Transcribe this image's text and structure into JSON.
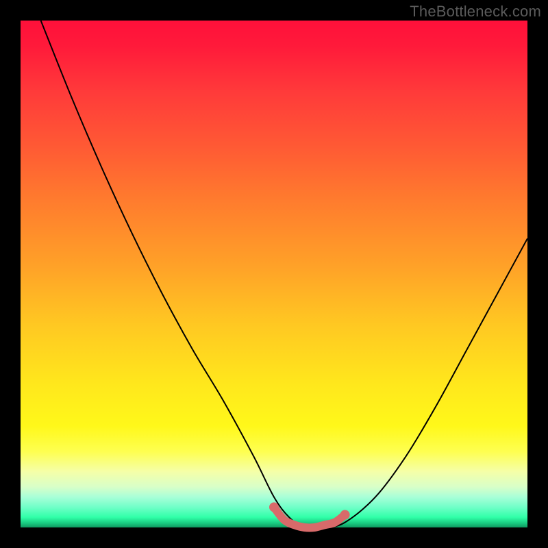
{
  "attribution": "TheBottleneck.com",
  "colors": {
    "frame": "#000000",
    "curve_main": "#000000",
    "curve_bottom_accent": "#d86a6a",
    "text": "#5b5b5b",
    "gradient_top": "#ff103a",
    "gradient_mid_upper": "#ff7a2e",
    "gradient_mid": "#ffe81c",
    "gradient_lower": "#feff50",
    "gradient_bottom": "#18c87e"
  },
  "chart_data": {
    "type": "line",
    "title": "",
    "xlabel": "",
    "ylabel": "",
    "xlim": [
      0,
      100
    ],
    "ylim": [
      0,
      100
    ],
    "grid": false,
    "legend": false,
    "series": [
      {
        "name": "bottleneck-curve",
        "x": [
          4,
          10,
          16,
          22,
          28,
          34,
          40,
          46,
          50,
          53,
          56,
          60,
          64,
          70,
          76,
          82,
          88,
          94,
          100
        ],
        "y": [
          100,
          85,
          71,
          58,
          46,
          35,
          25,
          14,
          6,
          2,
          0,
          0,
          1,
          6,
          14,
          24,
          35,
          46,
          57
        ]
      },
      {
        "name": "bottleneck-curve-flat-accent",
        "x": [
          50,
          52,
          54,
          56,
          58,
          60,
          62,
          64
        ],
        "y": [
          4,
          1.5,
          0.5,
          0,
          0,
          0.5,
          1,
          2.5
        ]
      }
    ]
  }
}
